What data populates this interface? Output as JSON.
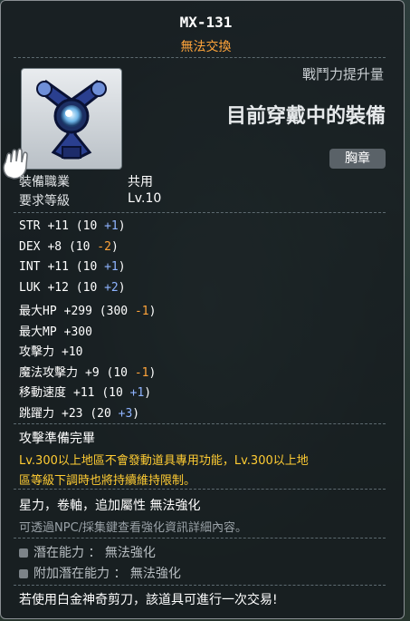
{
  "item": {
    "name": "MX-131",
    "trade_status": "無法交換",
    "combat_power_label": "戰鬥力提升量",
    "equipped_label": "目前穿戴中的裝備",
    "slot": "胸章"
  },
  "requirements": [
    {
      "label": "裝備職業",
      "value": "共用"
    },
    {
      "label": "要求等級",
      "value": "Lv.10"
    }
  ],
  "stats": [
    {
      "label": "STR",
      "value": "+11",
      "detail_open": " (10 ",
      "bonus": "+1",
      "bonus_color": "blue",
      "detail_close": ")"
    },
    {
      "label": "DEX",
      "value": "+8",
      "detail_open": " (10 ",
      "bonus": "-2",
      "bonus_color": "orange",
      "detail_close": ")"
    },
    {
      "label": "INT",
      "value": "+11",
      "detail_open": " (10 ",
      "bonus": "+1",
      "bonus_color": "blue",
      "detail_close": ")"
    },
    {
      "label": "LUK",
      "value": "+12",
      "detail_open": " (10 ",
      "bonus": "+2",
      "bonus_color": "blue",
      "detail_close": ")"
    },
    {
      "label": "最大HP",
      "value": "+299",
      "detail_open": " (300 ",
      "bonus": "-1",
      "bonus_color": "orange",
      "detail_close": ")"
    },
    {
      "label": "最大MP",
      "value": "+300",
      "detail_open": "",
      "bonus": "",
      "bonus_color": "",
      "detail_close": ""
    },
    {
      "label": "攻擊力",
      "value": "+10",
      "detail_open": "",
      "bonus": "",
      "bonus_color": "",
      "detail_close": ""
    },
    {
      "label": "魔法攻擊力",
      "value": "+9",
      "detail_open": " (10 ",
      "bonus": "-1",
      "bonus_color": "orange",
      "detail_close": ")"
    },
    {
      "label": "移動速度",
      "value": "+11",
      "detail_open": " (10 ",
      "bonus": "+1",
      "bonus_color": "blue",
      "detail_close": ")"
    },
    {
      "label": "跳躍力",
      "value": "+23",
      "detail_open": " (20 ",
      "bonus": "+3",
      "bonus_color": "blue",
      "detail_close": ")"
    }
  ],
  "description": {
    "header": "攻擊準備完畢",
    "note_line1": "Lv.300以上地區不會發動道具專用功能，Lv.300以上地",
    "note_line2": "區等級下調時也將持續維持限制。",
    "enhance_line": "星力，卷軸，追加屬性 無法強化",
    "hint_line": "可透過NPC/採集鍵查看強化資訊詳細內容。"
  },
  "potentials": [
    {
      "label": "潛在能力 ： 無法強化"
    },
    {
      "label": "附加潛在能力 ： 無法強化"
    }
  ],
  "scissors_note": "若使用白金神奇剪刀，該道具可進行一次交易!",
  "colors": {
    "orange": "#ffa43a",
    "blue": "#8fb4ff",
    "yellow": "#ffcc33"
  }
}
